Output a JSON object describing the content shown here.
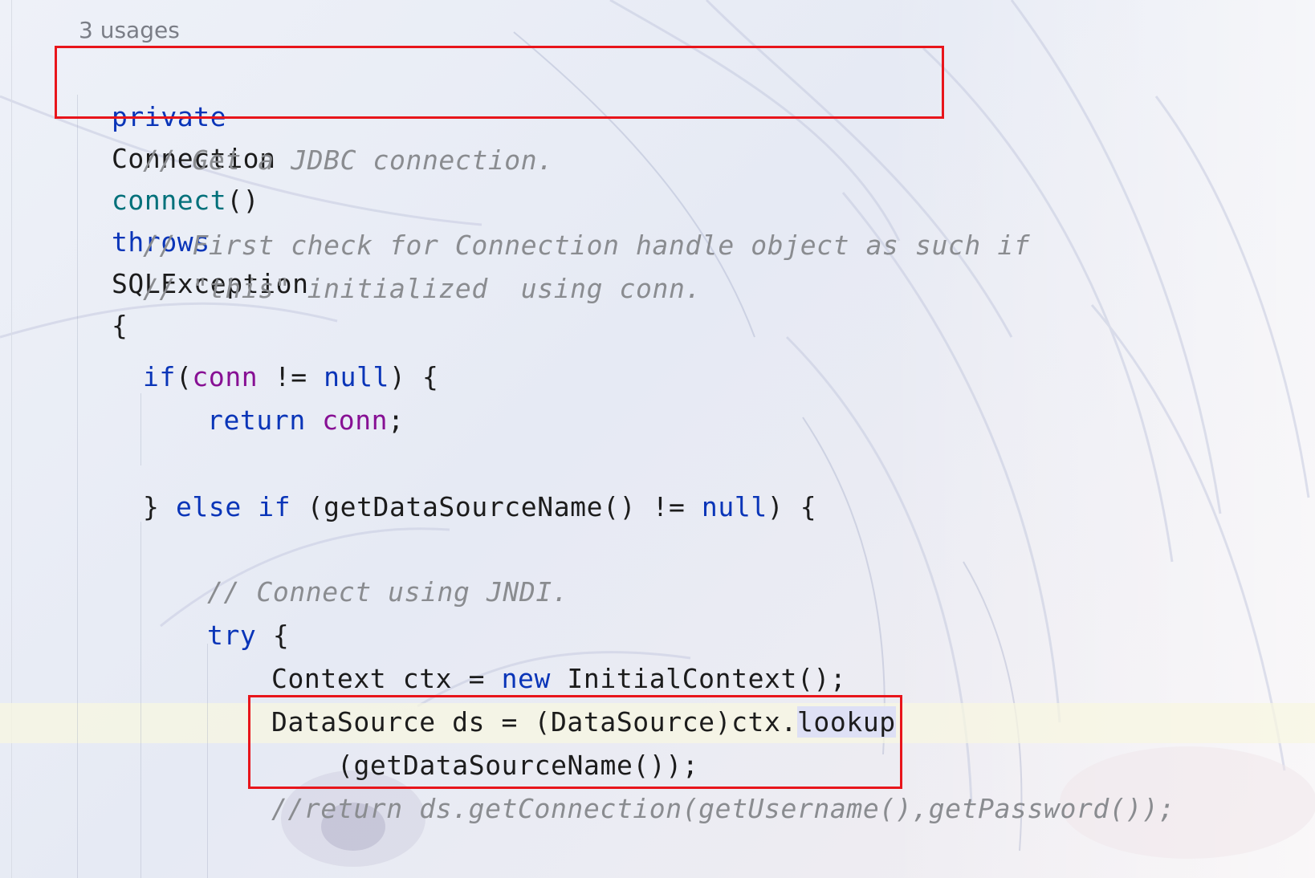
{
  "editor": {
    "usages_hint": "3 usages",
    "lines": {
      "l1": {
        "kw_private": "private",
        "type_connection": "Connection",
        "method_connect": "connect",
        "parens": "()",
        "kw_throws": "throws",
        "type_sqlexception": "SQLException",
        "brace_open": "{"
      },
      "l2": {
        "comment": "// Get a JDBC connection."
      },
      "l3": {
        "comment": "// First check for Connection handle object as such if"
      },
      "l4": {
        "comment": "// \"this\" initialized  using conn."
      },
      "l5": {
        "kw_if": "if",
        "paren_open": "(",
        "field_conn": "conn",
        "op_ne": " != ",
        "kw_null": "null",
        "tail": ") {"
      },
      "l6": {
        "kw_return": "return",
        "field_conn": "conn",
        "semi": ";"
      },
      "l7": {
        "brace_close": "} ",
        "kw_else": "else",
        "kw_if": "if",
        "middle": " (getDataSourceName() != ",
        "kw_null": "null",
        "tail": ") {"
      },
      "l8": {
        "comment": "// Connect using JNDI."
      },
      "l9": {
        "kw_try": "try",
        "tail": " {"
      },
      "l10": {
        "head": "Context ctx = ",
        "kw_new": "new",
        "tail": " InitialContext();"
      },
      "l11": {
        "head": "DataSource ds = (DataSource)ctx.",
        "method_lookup": "lookup"
      },
      "l12": {
        "text": "(getDataSourceName());"
      },
      "l13": {
        "comment": "//return ds.getConnection(getUsername(),getPassword());"
      }
    }
  },
  "colors": {
    "keyword": "#0a35b8",
    "method_decl": "#00707a",
    "field": "#871094",
    "comment": "#8a8c90",
    "highlight_box": "#e8151b",
    "current_line": "#f8f6e0"
  }
}
